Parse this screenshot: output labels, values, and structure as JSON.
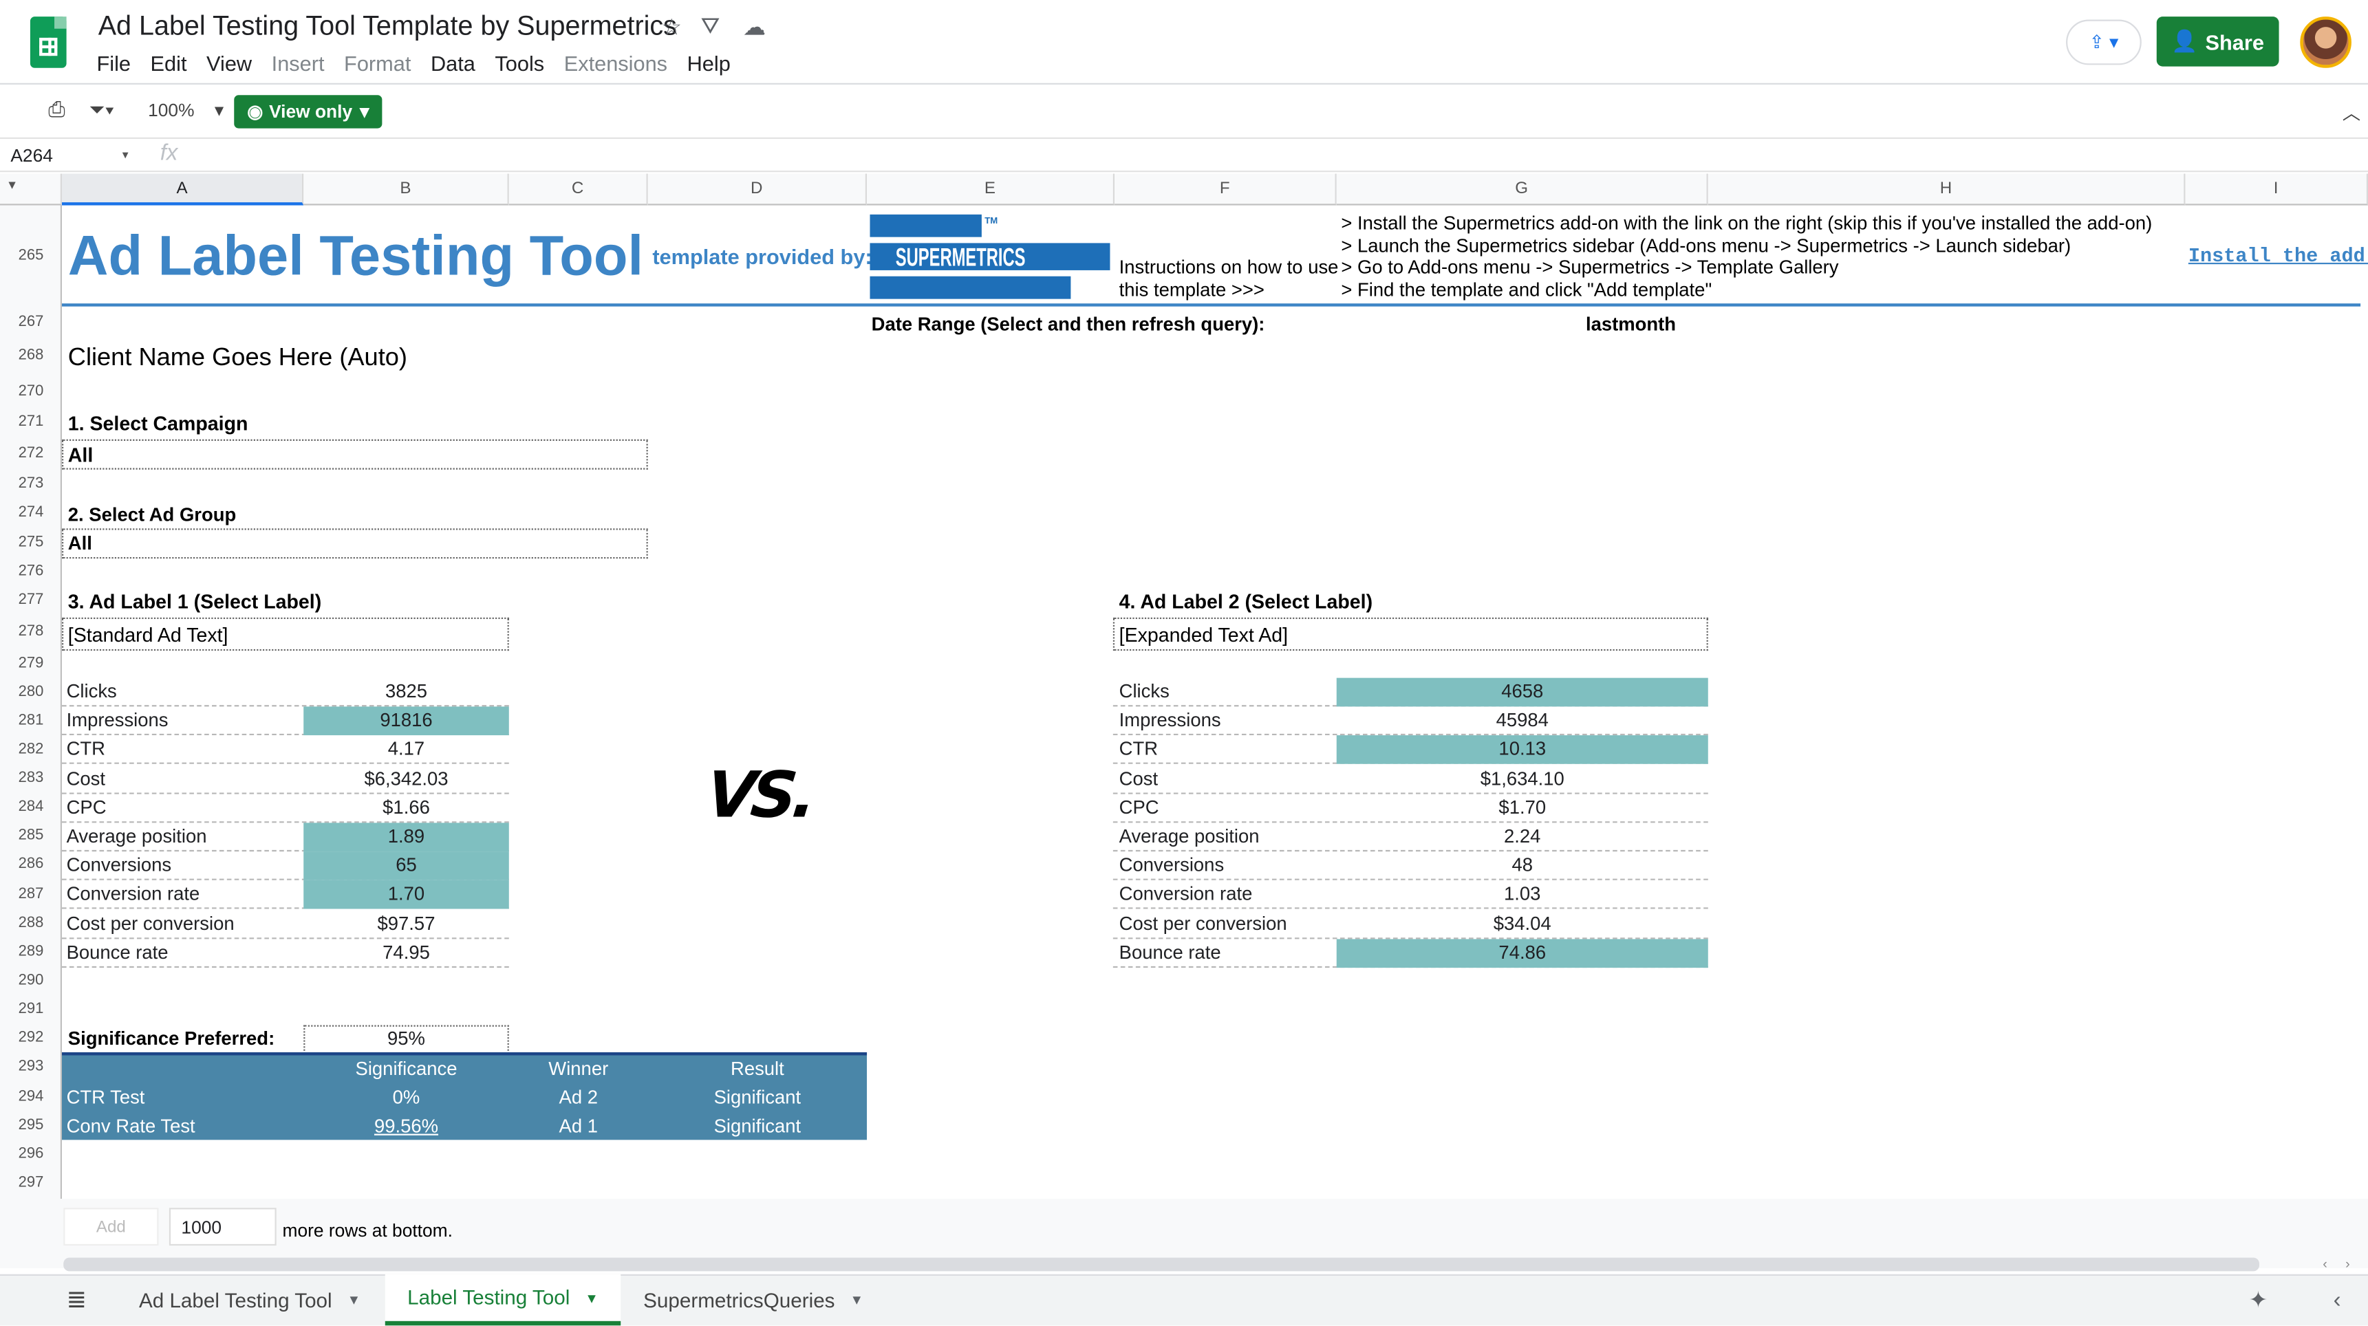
{
  "header": {
    "doc_title": "Ad Label Testing Tool Template by Supermetrics",
    "menu": [
      "File",
      "Edit",
      "View",
      "Insert",
      "Format",
      "Data",
      "Tools",
      "Extensions",
      "Help"
    ],
    "share_label": "Share"
  },
  "toolbar": {
    "zoom": "100%",
    "view_only": "View only"
  },
  "formula": {
    "cell_ref": "A264",
    "fx": "fx"
  },
  "columns": [
    "A",
    "B",
    "C",
    "D",
    "E",
    "F",
    "G",
    "H",
    "I"
  ],
  "rows": [
    "265",
    "267",
    "268",
    "270",
    "271",
    "272",
    "273",
    "274",
    "275",
    "276",
    "277",
    "278",
    "279",
    "280",
    "281",
    "282",
    "283",
    "284",
    "285",
    "286",
    "287",
    "288",
    "289",
    "290",
    "291",
    "292",
    "293",
    "294",
    "295",
    "296",
    "297"
  ],
  "banner": {
    "title": "Ad Label Testing Tool",
    "provided_by": "template provided by:",
    "logo_text": "SUPERMETRICS",
    "logo_tm": "TM",
    "how_to": [
      "Instructions on how to use",
      "this template  >>>"
    ],
    "steps": [
      "> Install the Supermetrics add-on with the link on the right (skip this if you've installed the add-on)",
      "> Launch the Supermetrics sidebar (Add-ons menu -> Supermetrics -> Launch sidebar)",
      "> Go to Add-ons menu -> Supermetrics -> Template Gallery",
      "> Find the template and click \"Add template\""
    ],
    "install_link": "Install the add-"
  },
  "date_range": {
    "label": "Date Range (Select and then refresh query):",
    "value": "lastmonth"
  },
  "client_name": "Client Name Goes Here (Auto)",
  "campaign": {
    "label": "1. Select Campaign",
    "value": "All"
  },
  "ad_group": {
    "label": "2. Select Ad Group",
    "value": "All"
  },
  "label1": {
    "heading": "3. Ad Label 1 (Select Label)",
    "value": "[Standard Ad Text]"
  },
  "label2": {
    "heading": "4. Ad Label 2 (Select Label)",
    "value": "[Expanded Text Ad]"
  },
  "vs": "VS.",
  "metrics": [
    {
      "name": "Clicks",
      "a1": "3825",
      "a2": "4658",
      "hl1": false,
      "hl2": true
    },
    {
      "name": "Impressions",
      "a1": "91816",
      "a2": "45984",
      "hl1": true,
      "hl2": false
    },
    {
      "name": "CTR",
      "a1": "4.17",
      "a2": "10.13",
      "hl1": false,
      "hl2": true
    },
    {
      "name": "Cost",
      "a1": "$6,342.03",
      "a2": "$1,634.10",
      "hl1": false,
      "hl2": false
    },
    {
      "name": "CPC",
      "a1": "$1.66",
      "a2": "$1.70",
      "hl1": false,
      "hl2": false
    },
    {
      "name": "Average position",
      "a1": "1.89",
      "a2": "2.24",
      "hl1": true,
      "hl2": false
    },
    {
      "name": "Conversions",
      "a1": "65",
      "a2": "48",
      "hl1": true,
      "hl2": false
    },
    {
      "name": "Conversion rate",
      "a1": "1.70",
      "a2": "1.03",
      "hl1": true,
      "hl2": false
    },
    {
      "name": "Cost per conversion",
      "a1": "$97.57",
      "a2": "$34.04",
      "hl1": false,
      "hl2": false
    },
    {
      "name": "Bounce rate",
      "a1": "74.95",
      "a2": "74.86",
      "hl1": false,
      "hl2": true
    }
  ],
  "significance": {
    "label": "Significance Preferred:",
    "value": "95%",
    "headers": [
      "Significance",
      "Winner",
      "Result"
    ],
    "rows": [
      {
        "test": "CTR Test",
        "sig": "0%",
        "winner": "Ad 2",
        "result": "Significant"
      },
      {
        "test": "Conv Rate Test",
        "sig": "99.56%",
        "winner": "Ad 1",
        "result": "Significant"
      }
    ]
  },
  "footer": {
    "add": "Add",
    "rows_value": "1000",
    "more_rows": "more rows at bottom."
  },
  "tabs": [
    "Ad Label Testing Tool",
    "Label Testing Tool",
    "SupermetricsQueries"
  ],
  "colors": {
    "accent": "#3d85c6",
    "highlight": "#7fbfc0",
    "result_bg": "#4a86a8",
    "green": "#188038"
  }
}
